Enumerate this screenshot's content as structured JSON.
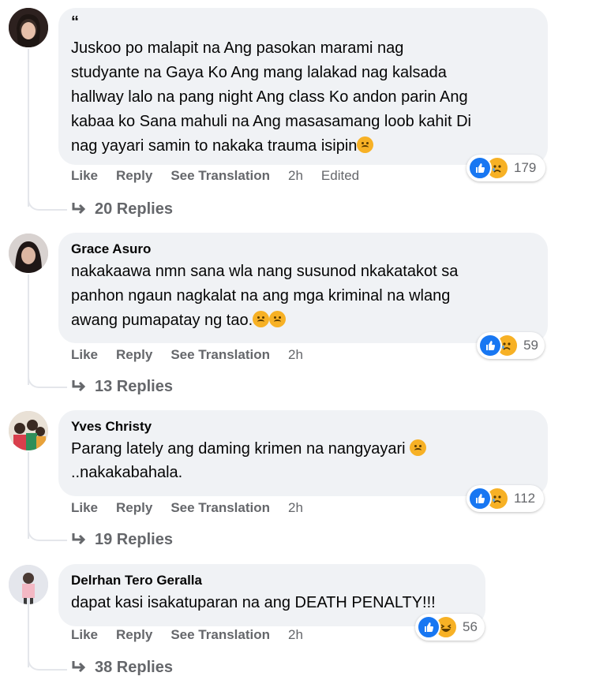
{
  "actions": {
    "like": "Like",
    "reply": "Reply",
    "see_translation": "See Translation"
  },
  "colors": {
    "bubble": "#f0f2f5",
    "meta_text": "#65676b",
    "like_blue": "#1877f2",
    "sad_yellow": "#f7b125"
  },
  "comments": [
    {
      "author": "“",
      "text": "Juskoo po malapit na Ang pasokan marami nag\nstudyante na Gaya Ko Ang mang lalakad nag kalsada\nhallway lalo na pang night Ang class Ko andon parin Ang\nkabaa ko Sana mahuli na Ang masasamang loob kahit Di\nnag yayari samin to nakaka trauma isipin",
      "emojis": [
        "crying-face"
      ],
      "time": "2h",
      "edited": "Edited",
      "reaction_icons": [
        "like",
        "sad"
      ],
      "reaction_count": "179",
      "replies": "20 Replies"
    },
    {
      "author": "Grace Asuro",
      "text": "nakakaawa nmn sana wla nang susunod nkakatakot sa\npanhon ngaun nagkalat na ang mga kriminal na wlang\nawang pumapatay ng tao.",
      "emojis": [
        "sad-face",
        "sad-face"
      ],
      "time": "2h",
      "reaction_icons": [
        "like",
        "sad"
      ],
      "reaction_count": "59",
      "replies": "13 Replies"
    },
    {
      "author": "Yves Christy",
      "text": "Parang lately ang daming krimen na nangyayari",
      "text2": "..nakakabahala.",
      "emojis": [
        "crying-face"
      ],
      "time": "2h",
      "reaction_icons": [
        "like",
        "sad"
      ],
      "reaction_count": "112",
      "replies": "19 Replies"
    },
    {
      "author": "Delrhan Tero Geralla",
      "text": "dapat kasi isakatuparan na ang DEATH PENALTY!!!",
      "time": "2h",
      "reaction_icons": [
        "like",
        "haha"
      ],
      "reaction_count": "56",
      "replies": "38 Replies"
    }
  ]
}
